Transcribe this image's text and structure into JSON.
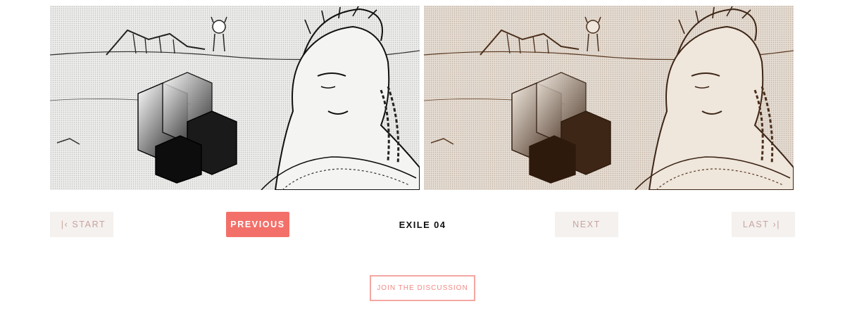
{
  "panels": [
    {
      "name": "grayscale",
      "tint": "#1a1a1a",
      "bg": "#ececea"
    },
    {
      "name": "sepia",
      "tint": "#5a3a22",
      "bg": "#e4dcd3"
    }
  ],
  "nav": {
    "start_label": "START",
    "start_glyph": "|‹",
    "previous_label": "PREVIOUS",
    "next_label": "NEXT",
    "last_label": "LAST",
    "last_glyph": "›|",
    "title": "EXILE 04"
  },
  "discussion": {
    "label": "JOIN THE DISCUSSION"
  },
  "colors": {
    "accent": "#f3706a",
    "disabled_bg": "#f4f1ef",
    "disabled_text": "#c9a39c",
    "outline": "#f4a7a2"
  }
}
